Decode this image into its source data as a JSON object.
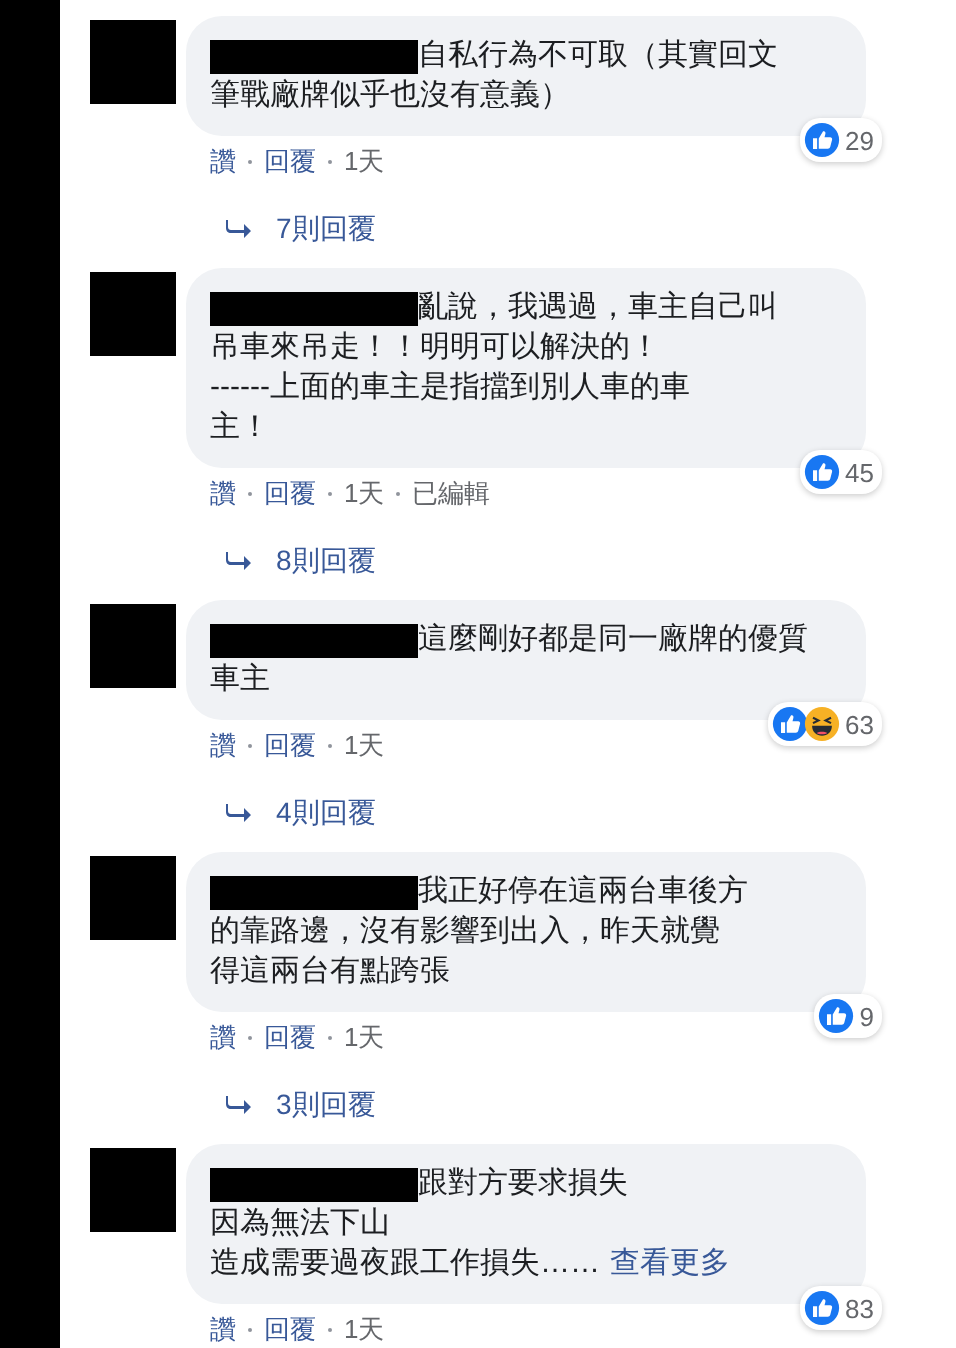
{
  "comments": [
    {
      "lines": [
        "自私行為不可取（其實回文",
        "筆戰廠牌似乎也沒有意義）"
      ],
      "reactions": [
        {
          "kind": "like"
        }
      ],
      "reaction_count": "29",
      "actions": [
        {
          "label": "讚",
          "kind": "link"
        },
        {
          "label": "回覆",
          "kind": "link"
        },
        {
          "label": "1天",
          "kind": "meta"
        }
      ],
      "replies": "7則回覆"
    },
    {
      "lines": [
        "亂說，我遇過，車主自己叫",
        "吊車來吊走！！明明可以解決的！",
        "------上面的車主是指擋到別人車的車",
        "主！"
      ],
      "reactions": [
        {
          "kind": "like"
        }
      ],
      "reaction_count": "45",
      "actions": [
        {
          "label": "讚",
          "kind": "link"
        },
        {
          "label": "回覆",
          "kind": "link"
        },
        {
          "label": "1天",
          "kind": "meta"
        },
        {
          "label": "已編輯",
          "kind": "meta"
        }
      ],
      "replies": "8則回覆"
    },
    {
      "lines": [
        "這麼剛好都是同一廠牌的優質",
        "車主"
      ],
      "reactions": [
        {
          "kind": "like"
        },
        {
          "kind": "haha"
        }
      ],
      "reaction_count": "63",
      "actions": [
        {
          "label": "讚",
          "kind": "link"
        },
        {
          "label": "回覆",
          "kind": "link"
        },
        {
          "label": "1天",
          "kind": "meta"
        }
      ],
      "replies": "4則回覆"
    },
    {
      "lines": [
        "我正好停在這兩台車後方",
        "的靠路邊，沒有影響到出入，昨天就覺",
        "得這兩台有點跨張"
      ],
      "reactions": [
        {
          "kind": "like"
        }
      ],
      "reaction_count": "9",
      "actions": [
        {
          "label": "讚",
          "kind": "link"
        },
        {
          "label": "回覆",
          "kind": "link"
        },
        {
          "label": "1天",
          "kind": "meta"
        }
      ],
      "replies": "3則回覆"
    },
    {
      "lines": [
        "跟對方要求損失",
        "因為無法下山",
        "造成需要過夜跟工作損失……"
      ],
      "see_more": "查看更多",
      "reactions": [
        {
          "kind": "like"
        }
      ],
      "reaction_count": "83",
      "actions": [
        {
          "label": "讚",
          "kind": "link"
        },
        {
          "label": "回覆",
          "kind": "link"
        },
        {
          "label": "1天",
          "kind": "meta"
        }
      ]
    }
  ]
}
